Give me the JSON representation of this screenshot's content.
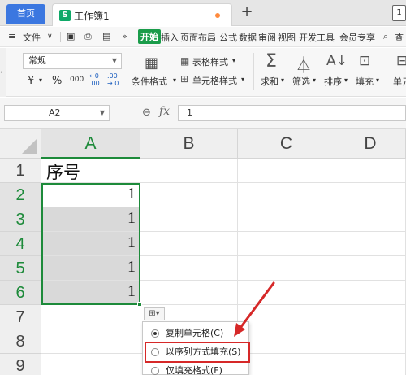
{
  "titlebar": {
    "home_tab": "首页",
    "doc_icon": "S",
    "doc_title": "工作簿1",
    "add_tab": "+",
    "page_indicator": "1"
  },
  "menubar": {
    "file_label": "文件",
    "more": "»",
    "items": [
      "开始",
      "插入",
      "页面布局",
      "公式",
      "数据",
      "审阅",
      "视图",
      "开发工具",
      "会员专享"
    ],
    "active_item": "开始",
    "search_label": "查"
  },
  "toolbar": {
    "number_format": "常规",
    "currency": "¥",
    "percent": "%",
    "thousands": "000",
    "inc_decimal": "+0\n.00",
    "dec_decimal": ".00\n→.0",
    "cond_format": "条件格式",
    "table_style": "表格样式",
    "cell_style": "单元格样式",
    "sum": "求和",
    "filter": "筛选",
    "sort": "排序",
    "fill": "填充",
    "single": "单元"
  },
  "formula_bar": {
    "name_box": "A2",
    "fx": "fx",
    "formula_value": "1"
  },
  "grid": {
    "columns": [
      "A",
      "B",
      "C",
      "D"
    ],
    "rows": [
      "1",
      "2",
      "3",
      "4",
      "5",
      "6",
      "7",
      "8",
      "9"
    ],
    "cells": {
      "A1": "序号",
      "A2": "1",
      "A3": "1",
      "A4": "1",
      "A5": "1",
      "A6": "1"
    }
  },
  "autofill": {
    "button_icon": "auto-fill-options-icon",
    "options": [
      {
        "label": "复制单元格(C)",
        "selected": true
      },
      {
        "label": "以序列方式填充(S)",
        "selected": false
      },
      {
        "label": "仅填充格式(F)",
        "selected": false
      }
    ]
  },
  "annotation": {
    "arrow_color": "#d62828"
  },
  "colors": {
    "accent_green": "#1d8a3a",
    "home_tab_blue": "#3b77e0",
    "active_menu_green": "#1a9c4a"
  }
}
